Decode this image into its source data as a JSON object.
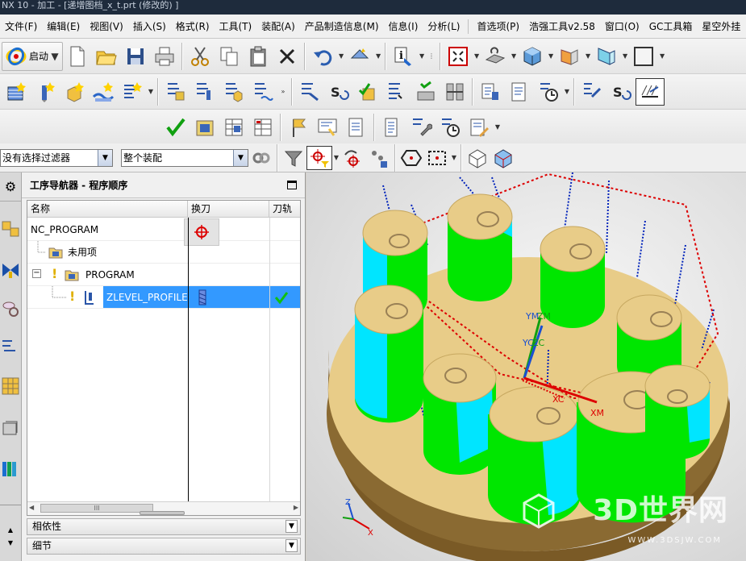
{
  "window": {
    "title": "NX 10 - 加工 - [递增图档_x_t.prt  (修改的) ]"
  },
  "menu": {
    "items": [
      "文件(F)",
      "编辑(E)",
      "视图(V)",
      "插入(S)",
      "格式(R)",
      "工具(T)",
      "装配(A)",
      "产品制造信息(M)",
      "信息(I)",
      "分析(L)",
      "首选项(P)",
      "浩强工具v2.58",
      "窗口(O)",
      "GC工具箱",
      "星空外挂"
    ]
  },
  "toolbar": {
    "start_label": "启动"
  },
  "filter": {
    "selection_filter": "没有选择过滤器",
    "assembly_scope": "整个装配"
  },
  "navigator": {
    "title": "工序导航器 - 程序顺序",
    "columns": [
      "名称",
      "换刀",
      "刀轨"
    ],
    "rows": [
      {
        "name": "NC_PROGRAM"
      },
      {
        "name": "未用项"
      },
      {
        "name": "PROGRAM",
        "toggle": "−"
      },
      {
        "name": "ZLEVEL_PROFILE",
        "selected": true
      }
    ],
    "scroll_grip": "III",
    "panels": [
      "相依性",
      "细节"
    ]
  },
  "viewport": {
    "axis_labels": {
      "ym": "YM",
      "zm": "ZM",
      "xm": "XM",
      "xc": "XC",
      "yc": "YC",
      "zc": "ZC",
      "triad_x": "X",
      "triad_z": "Z"
    },
    "watermark": "3D世界网",
    "watermark_sub": "WWW.3DSJW.COM"
  },
  "colors": {
    "accent": "#3399ff",
    "stock": "#e8cc88",
    "part_side": "#00e600",
    "cut_face": "#00e5ff",
    "path_red": "#dd0000",
    "path_blue": "#0022bb"
  }
}
